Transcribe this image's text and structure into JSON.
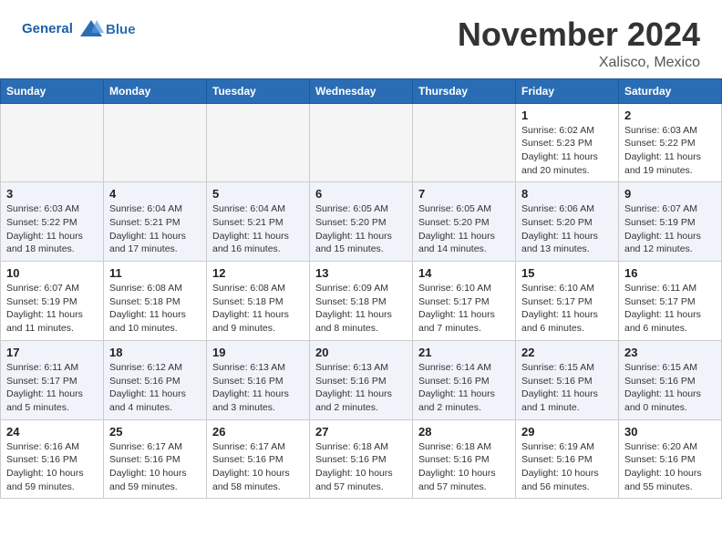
{
  "header": {
    "logo": {
      "line1": "General",
      "line2": "Blue"
    },
    "month": "November 2024",
    "location": "Xalisco, Mexico"
  },
  "weekdays": [
    "Sunday",
    "Monday",
    "Tuesday",
    "Wednesday",
    "Thursday",
    "Friday",
    "Saturday"
  ],
  "weeks": [
    [
      {
        "day": "",
        "info": ""
      },
      {
        "day": "",
        "info": ""
      },
      {
        "day": "",
        "info": ""
      },
      {
        "day": "",
        "info": ""
      },
      {
        "day": "",
        "info": ""
      },
      {
        "day": "1",
        "info": "Sunrise: 6:02 AM\nSunset: 5:23 PM\nDaylight: 11 hours and 20 minutes."
      },
      {
        "day": "2",
        "info": "Sunrise: 6:03 AM\nSunset: 5:22 PM\nDaylight: 11 hours and 19 minutes."
      }
    ],
    [
      {
        "day": "3",
        "info": "Sunrise: 6:03 AM\nSunset: 5:22 PM\nDaylight: 11 hours and 18 minutes."
      },
      {
        "day": "4",
        "info": "Sunrise: 6:04 AM\nSunset: 5:21 PM\nDaylight: 11 hours and 17 minutes."
      },
      {
        "day": "5",
        "info": "Sunrise: 6:04 AM\nSunset: 5:21 PM\nDaylight: 11 hours and 16 minutes."
      },
      {
        "day": "6",
        "info": "Sunrise: 6:05 AM\nSunset: 5:20 PM\nDaylight: 11 hours and 15 minutes."
      },
      {
        "day": "7",
        "info": "Sunrise: 6:05 AM\nSunset: 5:20 PM\nDaylight: 11 hours and 14 minutes."
      },
      {
        "day": "8",
        "info": "Sunrise: 6:06 AM\nSunset: 5:20 PM\nDaylight: 11 hours and 13 minutes."
      },
      {
        "day": "9",
        "info": "Sunrise: 6:07 AM\nSunset: 5:19 PM\nDaylight: 11 hours and 12 minutes."
      }
    ],
    [
      {
        "day": "10",
        "info": "Sunrise: 6:07 AM\nSunset: 5:19 PM\nDaylight: 11 hours and 11 minutes."
      },
      {
        "day": "11",
        "info": "Sunrise: 6:08 AM\nSunset: 5:18 PM\nDaylight: 11 hours and 10 minutes."
      },
      {
        "day": "12",
        "info": "Sunrise: 6:08 AM\nSunset: 5:18 PM\nDaylight: 11 hours and 9 minutes."
      },
      {
        "day": "13",
        "info": "Sunrise: 6:09 AM\nSunset: 5:18 PM\nDaylight: 11 hours and 8 minutes."
      },
      {
        "day": "14",
        "info": "Sunrise: 6:10 AM\nSunset: 5:17 PM\nDaylight: 11 hours and 7 minutes."
      },
      {
        "day": "15",
        "info": "Sunrise: 6:10 AM\nSunset: 5:17 PM\nDaylight: 11 hours and 6 minutes."
      },
      {
        "day": "16",
        "info": "Sunrise: 6:11 AM\nSunset: 5:17 PM\nDaylight: 11 hours and 6 minutes."
      }
    ],
    [
      {
        "day": "17",
        "info": "Sunrise: 6:11 AM\nSunset: 5:17 PM\nDaylight: 11 hours and 5 minutes."
      },
      {
        "day": "18",
        "info": "Sunrise: 6:12 AM\nSunset: 5:16 PM\nDaylight: 11 hours and 4 minutes."
      },
      {
        "day": "19",
        "info": "Sunrise: 6:13 AM\nSunset: 5:16 PM\nDaylight: 11 hours and 3 minutes."
      },
      {
        "day": "20",
        "info": "Sunrise: 6:13 AM\nSunset: 5:16 PM\nDaylight: 11 hours and 2 minutes."
      },
      {
        "day": "21",
        "info": "Sunrise: 6:14 AM\nSunset: 5:16 PM\nDaylight: 11 hours and 2 minutes."
      },
      {
        "day": "22",
        "info": "Sunrise: 6:15 AM\nSunset: 5:16 PM\nDaylight: 11 hours and 1 minute."
      },
      {
        "day": "23",
        "info": "Sunrise: 6:15 AM\nSunset: 5:16 PM\nDaylight: 11 hours and 0 minutes."
      }
    ],
    [
      {
        "day": "24",
        "info": "Sunrise: 6:16 AM\nSunset: 5:16 PM\nDaylight: 10 hours and 59 minutes."
      },
      {
        "day": "25",
        "info": "Sunrise: 6:17 AM\nSunset: 5:16 PM\nDaylight: 10 hours and 59 minutes."
      },
      {
        "day": "26",
        "info": "Sunrise: 6:17 AM\nSunset: 5:16 PM\nDaylight: 10 hours and 58 minutes."
      },
      {
        "day": "27",
        "info": "Sunrise: 6:18 AM\nSunset: 5:16 PM\nDaylight: 10 hours and 57 minutes."
      },
      {
        "day": "28",
        "info": "Sunrise: 6:18 AM\nSunset: 5:16 PM\nDaylight: 10 hours and 57 minutes."
      },
      {
        "day": "29",
        "info": "Sunrise: 6:19 AM\nSunset: 5:16 PM\nDaylight: 10 hours and 56 minutes."
      },
      {
        "day": "30",
        "info": "Sunrise: 6:20 AM\nSunset: 5:16 PM\nDaylight: 10 hours and 55 minutes."
      }
    ]
  ]
}
